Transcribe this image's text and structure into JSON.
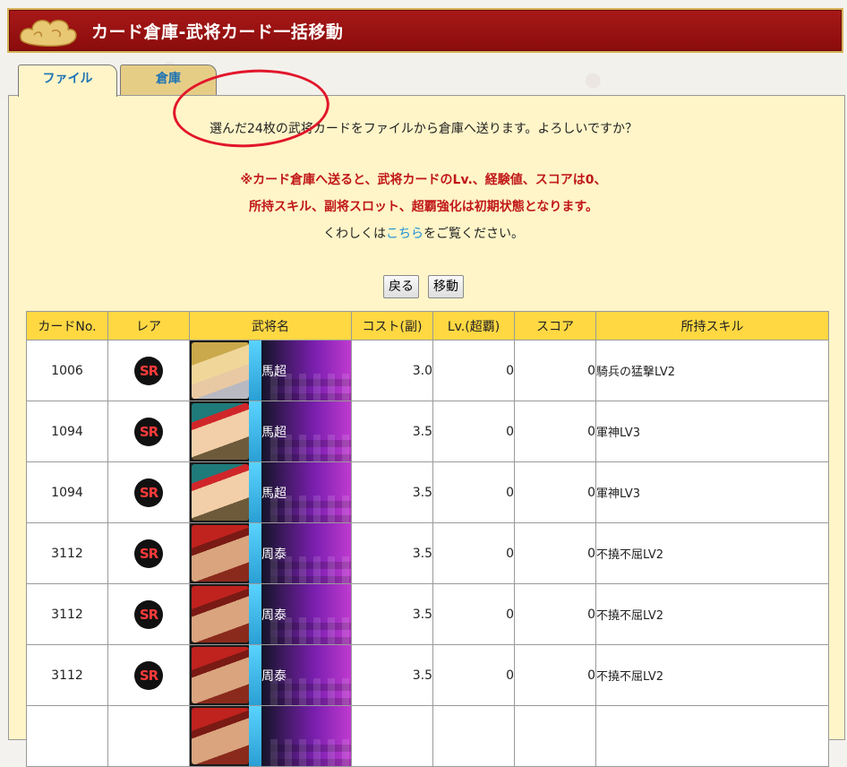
{
  "header": {
    "title": "カード倉庫-武将カード一括移動"
  },
  "tabs": [
    {
      "label": "ファイル",
      "active": true
    },
    {
      "label": "倉庫",
      "active": false
    }
  ],
  "message": {
    "confirm": "選んだ24枚の武将カードをファイルから倉庫へ送ります。よろしいですか？",
    "warning_line1": "※カード倉庫へ送ると、武将カードのLv.、経験値、スコアは0、",
    "warning_line2": "所持スキル、副将スロット、超覇強化は初期状態となります。",
    "detail_prefix": "くわしくは",
    "detail_link": "こちら",
    "detail_suffix": "をご覧ください。"
  },
  "buttons": {
    "back": "戻る",
    "move": "移動"
  },
  "table": {
    "headers": [
      "カードNo.",
      "レア",
      "武将名",
      "コスト(副)",
      "Lv.(超覇)",
      "スコア",
      "所持スキル"
    ],
    "rows": [
      {
        "no": "1006",
        "rarity": "SR",
        "name": "馬超",
        "cost": "3.0",
        "lv": "0",
        "score": "0",
        "skill": "騎兵の猛撃LV2",
        "face": "gold"
      },
      {
        "no": "1094",
        "rarity": "SR",
        "name": "馬超",
        "cost": "3.5",
        "lv": "0",
        "score": "0",
        "skill": "軍神LV3",
        "face": "teal"
      },
      {
        "no": "1094",
        "rarity": "SR",
        "name": "馬超",
        "cost": "3.5",
        "lv": "0",
        "score": "0",
        "skill": "軍神LV3",
        "face": "teal"
      },
      {
        "no": "3112",
        "rarity": "SR",
        "name": "周泰",
        "cost": "3.5",
        "lv": "0",
        "score": "0",
        "skill": "不撓不屈LV2",
        "face": "red"
      },
      {
        "no": "3112",
        "rarity": "SR",
        "name": "周泰",
        "cost": "3.5",
        "lv": "0",
        "score": "0",
        "skill": "不撓不屈LV2",
        "face": "red"
      },
      {
        "no": "3112",
        "rarity": "SR",
        "name": "周泰",
        "cost": "3.5",
        "lv": "0",
        "score": "0",
        "skill": "不撓不屈LV2",
        "face": "red"
      },
      {
        "no": "",
        "rarity": "",
        "name": "",
        "cost": "",
        "lv": "",
        "score": "",
        "skill": "",
        "face": "red"
      }
    ]
  },
  "colors": {
    "header_red": "#8a0c0c",
    "panel_cream": "#fff5c8",
    "table_header_yellow": "#ffd842",
    "warning_red": "#c01818",
    "link_blue": "#1e90d6",
    "annotation_circle": "#e2162a"
  }
}
